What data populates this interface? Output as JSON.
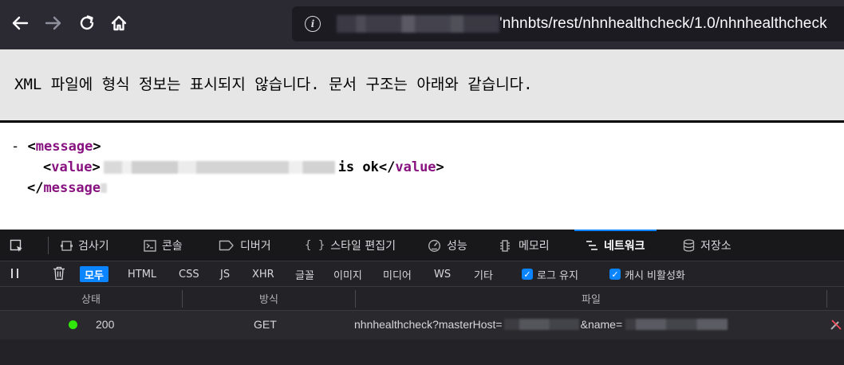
{
  "browser": {
    "url_visible": "'nhnbts/rest/nhnhealthcheck/1.0/nhnhealthcheck",
    "icons": {
      "back": "arrow-left-icon",
      "forward": "arrow-right-icon",
      "reload": "reload-icon",
      "home": "home-icon",
      "info": "info-icon"
    }
  },
  "notice": {
    "text": "XML 파일에 형식 정보는 표시되지 않습니다. 문서 구조는 아래와 같습니다."
  },
  "xml": {
    "collapse": "- ",
    "open_tag": "message",
    "value_tag": "value",
    "value_suffix": "is ok",
    "close_tag": "message"
  },
  "devtools": {
    "tabs": [
      {
        "label": "검사기",
        "icon": "inspector-icon"
      },
      {
        "label": "콘솔",
        "icon": "console-icon"
      },
      {
        "label": "디버거",
        "icon": "debugger-icon"
      },
      {
        "label": "스타일 편집기",
        "icon": "style-editor-icon"
      },
      {
        "label": "성능",
        "icon": "performance-icon"
      },
      {
        "label": "메모리",
        "icon": "memory-icon"
      },
      {
        "label": "네트워크",
        "icon": "network-icon"
      },
      {
        "label": "저장소",
        "icon": "storage-icon"
      }
    ],
    "active_tab": "네트워크",
    "filters": [
      "모두",
      "HTML",
      "CSS",
      "JS",
      "XHR",
      "글꼴",
      "이미지",
      "미디어",
      "WS",
      "기타"
    ],
    "active_filter": "모두",
    "checkboxes": [
      {
        "label": "로그 유지",
        "checked": true
      },
      {
        "label": "캐시 비활성화",
        "checked": true
      }
    ],
    "columns": [
      "상태",
      "방식",
      "파일"
    ],
    "rows": [
      {
        "status": "200",
        "method": "GET",
        "file_prefix": "nhnhealthcheck?masterHost=",
        "file_middle": "&name="
      }
    ],
    "colors": {
      "accent": "#0a84ff",
      "status_ok": "#30e60b",
      "tag": "#881280"
    }
  }
}
